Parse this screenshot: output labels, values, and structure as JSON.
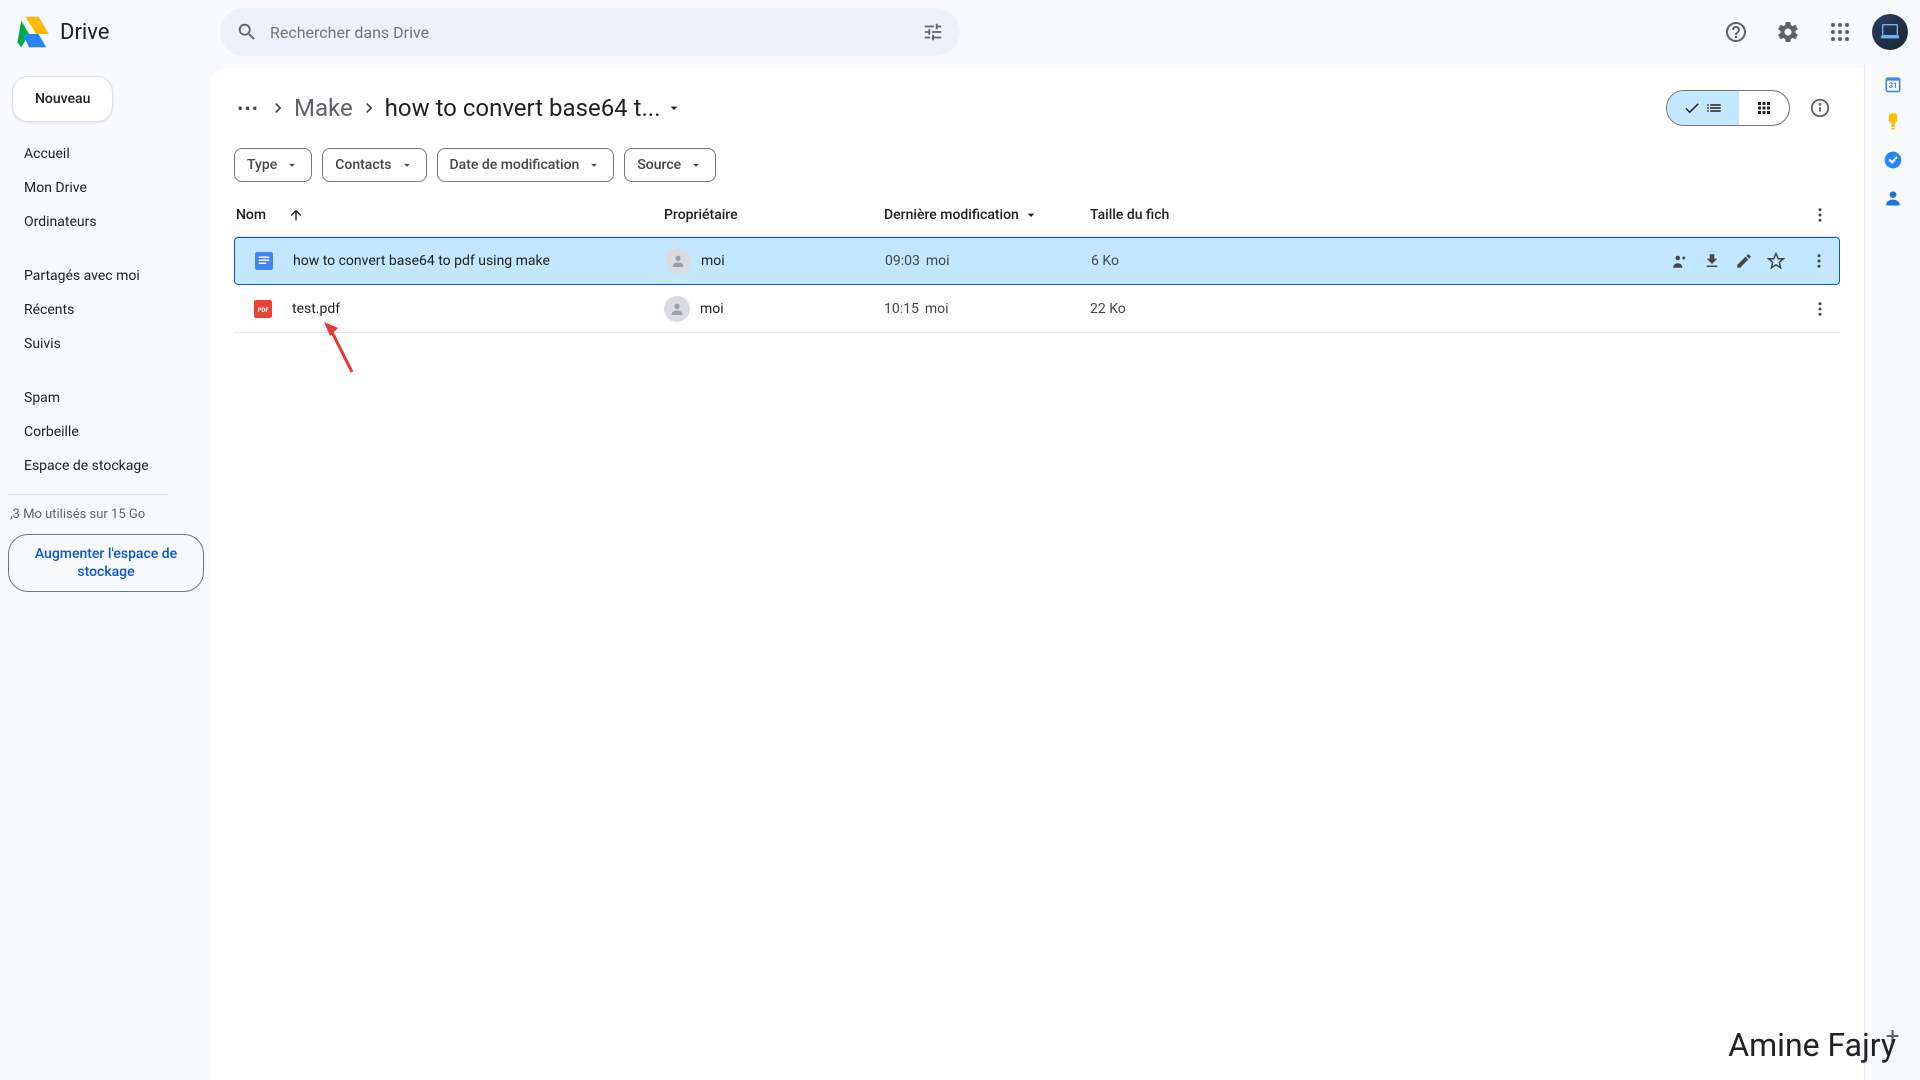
{
  "header": {
    "app_name": "Drive",
    "search_placeholder": "Rechercher dans Drive"
  },
  "sidebar": {
    "new_button": "Nouveau",
    "items": [
      "Accueil",
      "Mon Drive",
      "Ordinateurs",
      "Partagés avec moi",
      "Récents",
      "Suivis",
      "Spam",
      "Corbeille",
      "Espace de stockage"
    ],
    "storage_text": ",3 Mo utilisés sur 15 Go",
    "upgrade_button": "Augmenter l'espace de stockage"
  },
  "breadcrumb": {
    "parent": "Make",
    "current": "how to convert base64 t..."
  },
  "filters": [
    "Type",
    "Contacts",
    "Date de modification",
    "Source"
  ],
  "columns": {
    "name": "Nom",
    "owner": "Propriétaire",
    "modified": "Dernière modification",
    "size": "Taille du fich"
  },
  "files": [
    {
      "name": "how to convert base64 to pdf using make",
      "owner": "moi",
      "modified_time": "09:03",
      "modified_by": "moi",
      "size": "6 Ko",
      "type": "doc",
      "selected": true
    },
    {
      "name": "test.pdf",
      "owner": "moi",
      "modified_time": "10:15",
      "modified_by": "moi",
      "size": "22 Ko",
      "type": "pdf",
      "selected": false
    }
  ],
  "watermark": "Amine Fajry"
}
